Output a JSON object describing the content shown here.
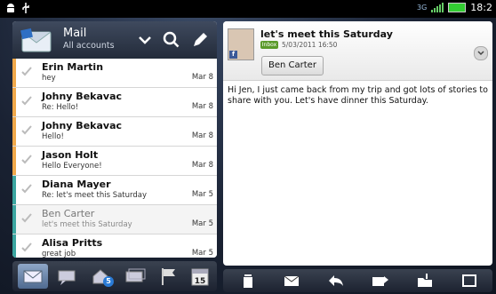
{
  "status_bar": {
    "time": "18:2",
    "network": "3G",
    "icons": [
      "android-robot-icon",
      "usb-icon",
      "signal-bars-icon",
      "battery-icon"
    ]
  },
  "mail_header": {
    "title": "Mail",
    "subtitle": "All accounts",
    "icons": [
      "envelope-icon",
      "chevron-down-icon",
      "search-icon",
      "compose-pencil-icon"
    ]
  },
  "messages": [
    {
      "sender": "Erin Martin",
      "preview": "hey",
      "date": "Mar 8",
      "read": false,
      "color": "#f0a84a"
    },
    {
      "sender": "Johny Bekavac",
      "preview": "Re: Hello!",
      "date": "Mar 8",
      "read": false,
      "color": "#f0a84a"
    },
    {
      "sender": "Johny Bekavac",
      "preview": "Hello!",
      "date": "Mar 8",
      "read": false,
      "color": "#f0a84a"
    },
    {
      "sender": "Jason Holt",
      "preview": "Hello Everyone!",
      "date": "Mar 8",
      "read": false,
      "color": "#f0a84a"
    },
    {
      "sender": "Diana Mayer",
      "preview": "Re: let's meet this Saturday",
      "date": "Mar 5",
      "read": false,
      "color": "#3aa5a0"
    },
    {
      "sender": "Ben Carter",
      "preview": "let's meet this Saturday",
      "date": "Mar 5",
      "read": true,
      "color": "#3aa5a0"
    },
    {
      "sender": "Alisa Pritts",
      "preview": "great job",
      "date": "Mar 5",
      "read": false,
      "color": "#3aa5a0"
    }
  ],
  "tabs": {
    "calendar_day": "15",
    "unread_badge": "5",
    "icons": [
      "inbox-envelope-icon",
      "conversation-icon",
      "group-mail-icon",
      "envelopes-icon",
      "flag-icon",
      "calendar-icon"
    ]
  },
  "message_view": {
    "subject": "let's meet this Saturday",
    "folder_tag": "Inbox",
    "datetime": "5/03/2011  16:50",
    "sender": "Ben Carter",
    "body": "Hi Jen, I just came back from my trip and got lots of stories to share with you. Let's have dinner this Saturday."
  },
  "toolbar_icons": [
    "delete-icon",
    "mark-unread-icon",
    "reply-icon",
    "forward-icon",
    "move-to-folder-icon",
    "fullscreen-icon"
  ]
}
